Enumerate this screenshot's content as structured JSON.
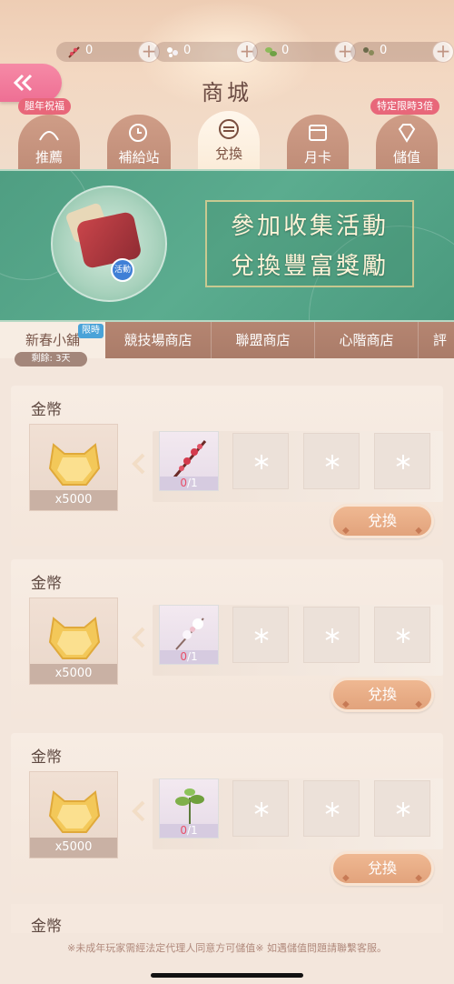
{
  "currencies": [
    {
      "icon": "peach-branch-icon",
      "value": "0"
    },
    {
      "icon": "white-flower-icon",
      "value": "0"
    },
    {
      "icon": "green-leaf-icon",
      "value": "0"
    },
    {
      "icon": "seed-pod-icon",
      "value": "0"
    }
  ],
  "page": {
    "title": "商城"
  },
  "badges": {
    "left": "腿年祝福",
    "right": "特定限時3倍"
  },
  "tabs": [
    {
      "label": "推薦",
      "icon": "recommend-icon"
    },
    {
      "label": "補給站",
      "icon": "clock-icon"
    },
    {
      "label": "兌換",
      "icon": "exchange-icon",
      "active": true
    },
    {
      "label": "月卡",
      "icon": "calendar-icon"
    },
    {
      "label": "儲值",
      "icon": "diamond-icon"
    }
  ],
  "banner": {
    "line1": "參加收集活動",
    "line2": "兌換豐富獎勵",
    "stamp": "活動"
  },
  "subtabs": [
    {
      "label": "新春小舖",
      "active": true
    },
    {
      "label": "競技場商店"
    },
    {
      "label": "聯盟商店"
    },
    {
      "label": "心階商店"
    },
    {
      "label": "評"
    }
  ],
  "limit_tag": "限時",
  "remaining": "剩餘: 3天",
  "offers": [
    {
      "title": "金幣",
      "reward_qty": "x5000",
      "material": "peach-branch",
      "count_have": "0",
      "count_need": "/1",
      "button": "兌換"
    },
    {
      "title": "金幣",
      "reward_qty": "x5000",
      "material": "white-flower",
      "count_have": "0",
      "count_need": "/1",
      "button": "兌換"
    },
    {
      "title": "金幣",
      "reward_qty": "x5000",
      "material": "green-leaf",
      "count_have": "0",
      "count_need": "/1",
      "button": "兌換"
    }
  ],
  "partial_offer": {
    "title": "金幣"
  },
  "footer": {
    "notice": "※未成年玩家需經法定代理人同意方可儲值※ 如遇儲值問題請聯繫客服。"
  },
  "colors": {
    "accent": "#e2a37c",
    "banner": "#4f9e82",
    "back": "#ee6f94"
  }
}
